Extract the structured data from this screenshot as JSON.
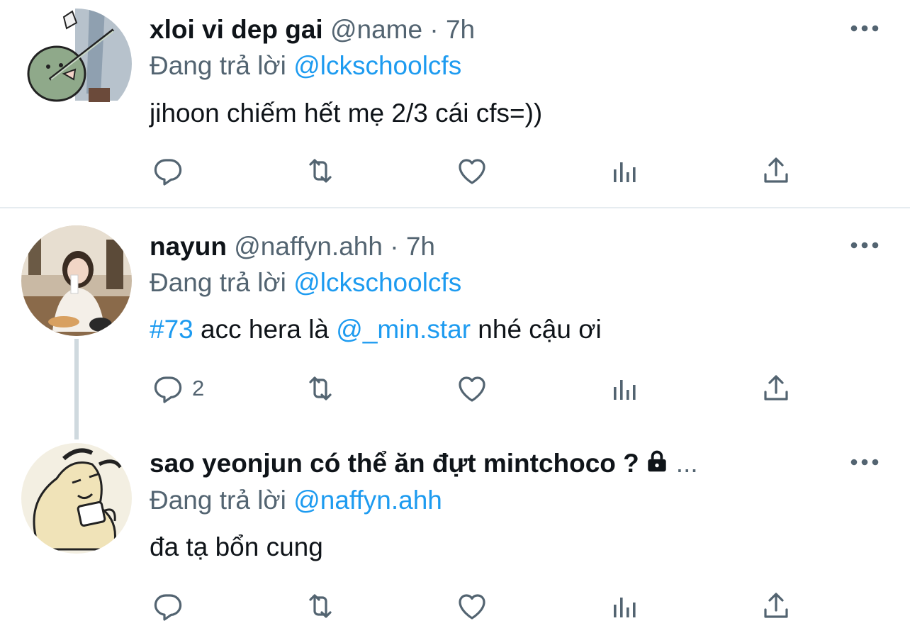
{
  "tweets": [
    {
      "name": "xloi vi dep gai",
      "handle": "@name",
      "separator": "·",
      "time": "7h",
      "reply_prefix": "Đang trả lời",
      "reply_to": "@lckschoolcfs",
      "text": "jihoon chiếm hết mẹ 2/3 cái cfs=))",
      "replies_count": "",
      "avatar": "cartoon-avatar"
    },
    {
      "name": "nayun",
      "handle": "@naffyn.ahh",
      "separator": "·",
      "time": "7h",
      "reply_prefix": "Đang trả lời",
      "reply_to": "@lckschoolcfs",
      "text_parts": {
        "hashtag": "#73",
        "mid": " acc hera là ",
        "mention": "@_min.star",
        "end": " nhé cậu ơi"
      },
      "replies_count": "2",
      "avatar": "photo-avatar"
    },
    {
      "name": "sao yeonjun có thể ăn đựt mintchoco ?",
      "name_suffix": "...",
      "locked": true,
      "reply_prefix": "Đang trả lời",
      "reply_to": "@naffyn.ahh",
      "text": "đa tạ bổn cung",
      "replies_count": "",
      "avatar": "cartoon-avatar"
    }
  ],
  "icons": {
    "reply": "reply-icon",
    "retweet": "retweet-icon",
    "like": "like-icon",
    "views": "views-icon",
    "share": "share-icon",
    "more": "more-icon",
    "lock": "lock-icon"
  },
  "colors": {
    "link": "#1d9bf0",
    "muted": "#536471",
    "text": "#0f1419"
  }
}
